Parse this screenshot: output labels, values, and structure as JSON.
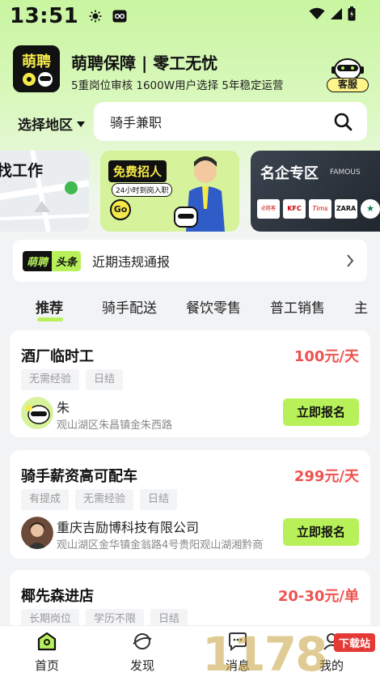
{
  "status": {
    "time": "13:51"
  },
  "brand": {
    "title": "萌聘保障 | 零工无忧",
    "subtitle": "5重岗位审核 1600W用户选择 5年稳定运营",
    "logo_text": "萌聘",
    "service_label": "客服"
  },
  "region": {
    "label": "选择地区"
  },
  "search": {
    "value": "骑手兼职"
  },
  "banners": {
    "map_title": "找工作",
    "recruit_title": "免费招人",
    "recruit_sub": "24小时到岗入职",
    "recruit_go": "Go",
    "famous_title": "名企专区",
    "famous_sub": "FAMOUS",
    "famous_brands": [
      "必胜客",
      "KFC",
      "Tims",
      "ZARA",
      "★"
    ]
  },
  "news": {
    "tag_a": "萌聘",
    "tag_b": "头条",
    "text": "近期违规通报"
  },
  "tabs": [
    "推荐",
    "骑手配送",
    "餐饮零售",
    "普工销售",
    "主"
  ],
  "jobs": [
    {
      "title": "酒厂临时工",
      "salary": "100元/天",
      "tags": [
        "无需经验",
        "日结"
      ],
      "company": "朱",
      "address": "观山湖区朱昌镇金朱西路",
      "apply": "立即报名"
    },
    {
      "title": "骑手薪资高可配车",
      "salary": "299元/天",
      "tags": [
        "有提成",
        "无需经验",
        "日结"
      ],
      "company": "重庆吉励博科技有限公司",
      "address": "观山湖区金华镇金翁路4号贵阳观山湖湘黔商",
      "apply": "立即报名"
    },
    {
      "title": "椰先森进店",
      "salary": "20-30元/单",
      "tags": [
        "长期岗位",
        "学历不限",
        "日结"
      ]
    }
  ],
  "nav": [
    "首页",
    "发现",
    "消息",
    "我的"
  ],
  "watermark": {
    "digits": "1178",
    "label": "下载站"
  },
  "colors": {
    "accent": "#b8f05a",
    "salary": "#ef5350"
  }
}
